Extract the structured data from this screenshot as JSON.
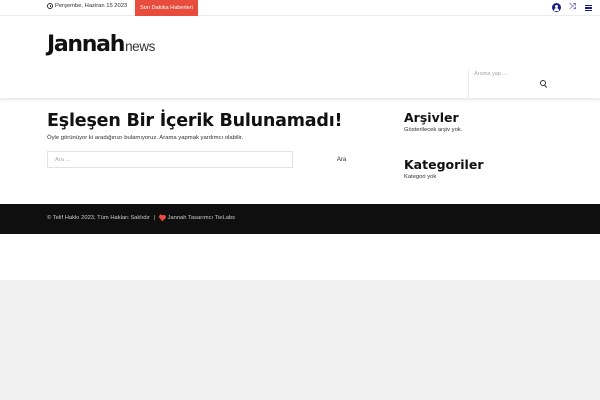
{
  "topbar": {
    "date": "Perşembe, Haziran 15 2023",
    "breaking_label": "Son Dakika Haberleri",
    "icons": [
      "user-icon",
      "shuffle-icon",
      "menu-icon"
    ]
  },
  "header": {
    "logo_main": "Jannah",
    "logo_sub": "news"
  },
  "nav": {
    "search_placeholder": "Arama yap ...",
    "search_icon": "search-icon"
  },
  "main": {
    "title": "Eşleşen Bir İçerik Bulunamadı!",
    "description": "Öyle görünüyor ki aradığınızı bulamıyoruz. Arama yapmak yardımcı olabilir.",
    "search_placeholder": "Ara ...",
    "search_button": "Ara"
  },
  "sidebar": {
    "archives_title": "Arşivler",
    "archives_text": "Gösterilecek arşiv yok.",
    "categories_title": "Kategoriler",
    "categories_text": "Kategori yok"
  },
  "footer": {
    "copyright": "© Telif Hakkı 2023, Tüm Hakları Saklıdır",
    "separator": "|",
    "credit": "Jannah Tasarımcı TieLabs"
  },
  "colors": {
    "accent": "#e74c3c",
    "icon_blue": "#1b1d8f",
    "footer_bg": "#0f0f0f",
    "page_bg": "#f0f0f0"
  }
}
